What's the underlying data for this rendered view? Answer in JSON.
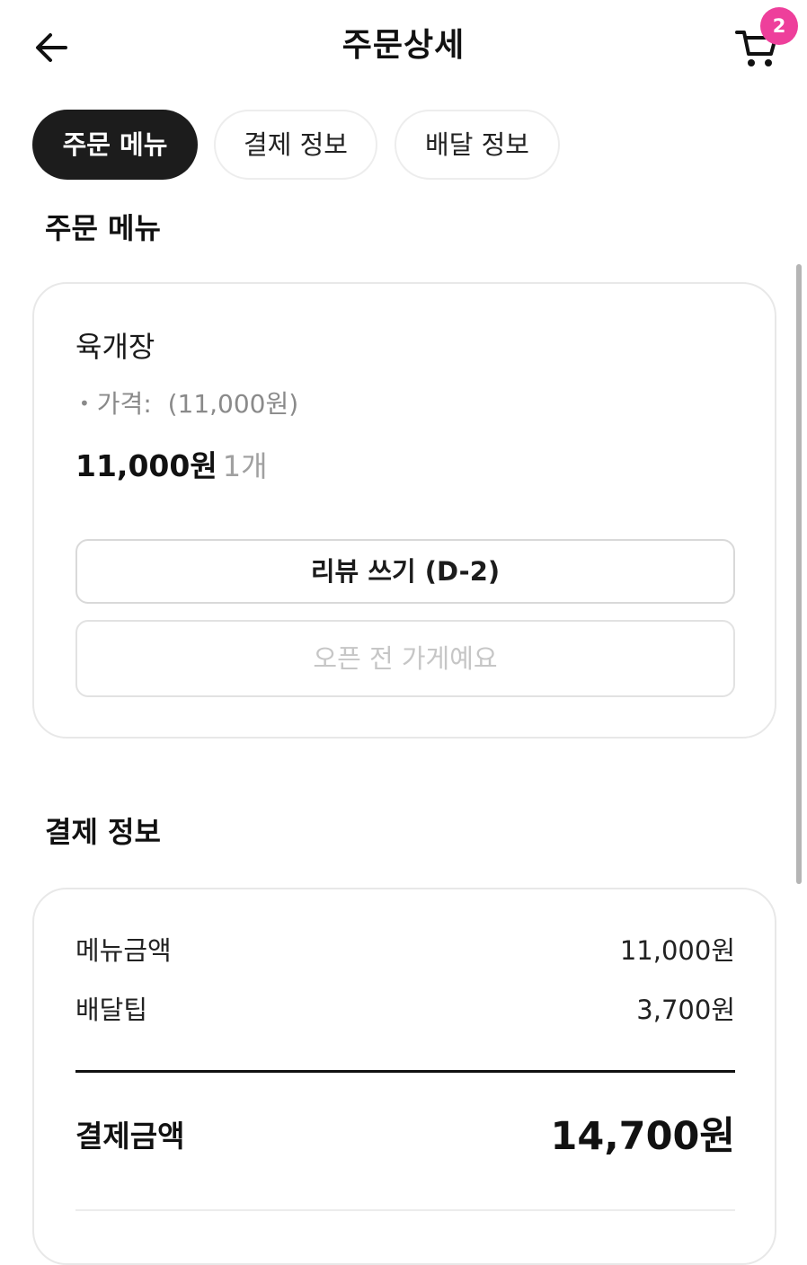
{
  "header": {
    "title": "주문상세",
    "back_icon": "arrow-left-icon",
    "cart_icon": "cart-icon",
    "cart_badge": "2",
    "badge_color": "#ee3f9b"
  },
  "tabs": [
    {
      "label": "주문 메뉴",
      "active": true
    },
    {
      "label": "결제 정보",
      "active": false
    },
    {
      "label": "배달 정보",
      "active": false
    }
  ],
  "order_menu": {
    "section_title": "주문 메뉴",
    "item": {
      "name": "육개장",
      "option_label": "가격:",
      "option_value": "(11,000원)",
      "price": "11,000원",
      "quantity": "1개"
    },
    "review_button": "리뷰 쓰기 (D-2)",
    "closed_button": "오픈 전 가게예요"
  },
  "payment_info": {
    "section_title": "결제 정보",
    "rows": [
      {
        "label": "메뉴금액",
        "value": "11,000원"
      },
      {
        "label": "배달팁",
        "value": "3,700원"
      }
    ],
    "total_label": "결제금액",
    "total_value": "14,700원"
  }
}
